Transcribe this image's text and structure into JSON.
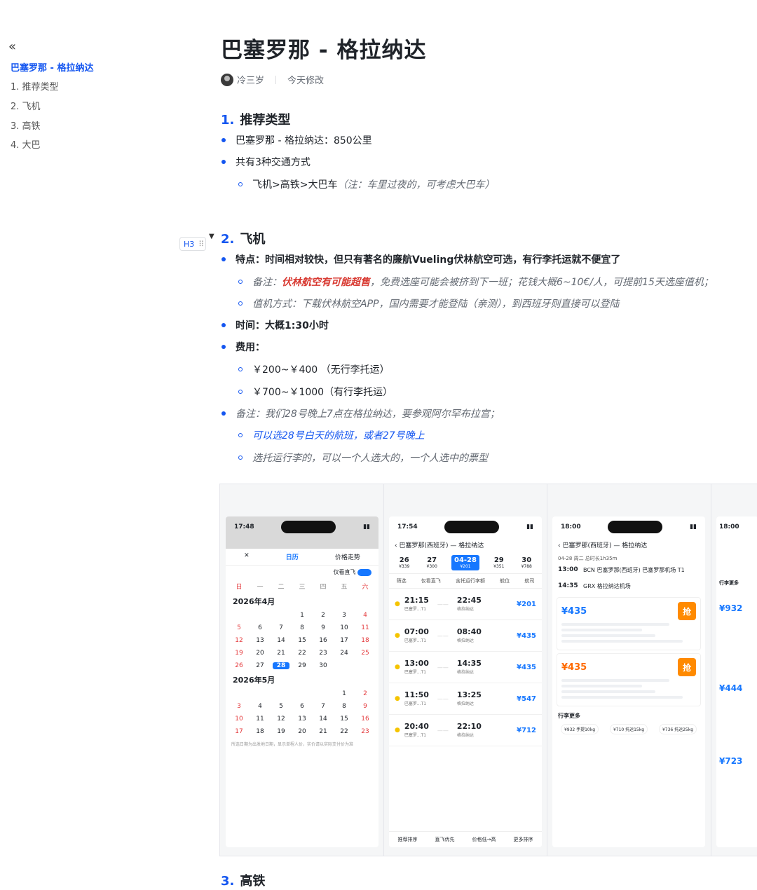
{
  "sidebar": {
    "collapse_icon": "«",
    "title": "巴塞罗那 - 格拉纳达",
    "items": [
      "1. 推荐类型",
      "2. 飞机",
      "3. 高铁",
      "4. 大巴"
    ]
  },
  "doc": {
    "title": "巴塞罗那 - 格拉纳达",
    "author": "冷三岁",
    "modified": "今天修改"
  },
  "sec1": {
    "num": "1.",
    "heading": "推荐类型",
    "b1": "巴塞罗那 - 格拉纳达：850公里",
    "b2": "共有3种交通方式",
    "b2a_main": "飞机>高铁>大巴车",
    "b2a_note": "（注：车里过夜的，可考虑大巴车）"
  },
  "sec2": {
    "num": "2.",
    "heading": "飞机",
    "h3_tag": "H3",
    "b1": "特点：时间相对较快，但只有著名的廉航Vueling伏林航空可选，有行李托运就不便宜了",
    "b1a_pre": "备注：",
    "b1a_red": "伏林航空有可能超售",
    "b1a_post": "，免费选座可能会被挤到下一班；花钱大概6~10€/人，可提前15天选座值机；",
    "b1b": "值机方式：下载伏林航空APP，国内需要才能登陆（亲测），到西班牙则直接可以登陆",
    "b2": "时间：大概1:30小时",
    "b3": "费用：",
    "b3a": "￥200~￥400 （无行李托运）",
    "b3b": "￥700~￥1000（有行李托运）",
    "b4": "备注：我们28号晚上7点在格拉纳达，要参观阿尔罕布拉宫；",
    "b4a": "可以选28号白天的航班，或者27号晚上",
    "b4b": "选托运行李的，可以一个人选大的，一个人选中的票型"
  },
  "shot1": {
    "time": "17:48",
    "tab_cal": "日历",
    "tab_trend": "价格走势",
    "direct": "仅看直飞",
    "weekdays": [
      "日",
      "一",
      "二",
      "三",
      "四",
      "五",
      "六"
    ],
    "month1": "2026年4月",
    "month2": "2026年5月",
    "apr": [
      [
        "",
        "",
        "",
        "1",
        "2",
        "3",
        "4"
      ],
      [
        "5",
        "6",
        "7",
        "8",
        "9",
        "10",
        "11"
      ],
      [
        "12",
        "13",
        "14",
        "15",
        "16",
        "17",
        "18"
      ],
      [
        "19",
        "20",
        "21",
        "22",
        "23",
        "24",
        "25"
      ],
      [
        "26",
        "27",
        "28",
        "29",
        "30",
        "",
        ""
      ]
    ],
    "may": [
      [
        "",
        "",
        "",
        "",
        "",
        "1",
        "2"
      ],
      [
        "3",
        "4",
        "5",
        "6",
        "7",
        "8",
        "9"
      ],
      [
        "10",
        "11",
        "12",
        "13",
        "14",
        "15",
        "16"
      ],
      [
        "17",
        "18",
        "19",
        "20",
        "21",
        "22",
        "23"
      ]
    ],
    "footer": "所选日期为出发地日期，显示单程人价，实价请以实际支付价为准"
  },
  "shot2": {
    "time": "17:54",
    "route": "巴塞罗那(西班牙) — 格拉纳达",
    "dates": [
      "26",
      "27",
      "04-28",
      "29",
      "30"
    ],
    "prices": [
      "¥339",
      "¥300",
      "¥201",
      "¥351",
      "¥788"
    ],
    "filters": [
      "筛选",
      "仅看直飞",
      "含托运行李额",
      "舱位",
      "航司"
    ],
    "flights": [
      {
        "dep": "21:15",
        "arr": "22:45",
        "price": "¥201"
      },
      {
        "dep": "07:00",
        "arr": "08:40",
        "price": "¥435"
      },
      {
        "dep": "13:00",
        "arr": "14:35",
        "price": "¥435"
      },
      {
        "dep": "11:50",
        "arr": "13:25",
        "price": "¥547"
      },
      {
        "dep": "20:40",
        "arr": "22:10",
        "price": "¥712"
      }
    ],
    "from": "巴塞罗...T1",
    "to": "格拉纳达",
    "nav": [
      "推荐排序",
      "直飞优先",
      "价格低→高",
      "更多排序"
    ]
  },
  "shot3": {
    "time": "18:00",
    "route": "巴塞罗那(西班牙) — 格拉纳达",
    "date": "04-28 周二  总时长1h35m",
    "dep_time": "13:00",
    "dep_ap": "BCN 巴塞罗那(西班牙) 巴塞罗那机场 T1",
    "arr_time": "14:35",
    "arr_ap": "GRX 格拉纳达机场",
    "fare1": "¥435",
    "fare2": "¥435",
    "grab": "抢",
    "more": "行李更多",
    "bag_opts": [
      "¥932 手提10kg",
      "¥710 托运15kg",
      "¥736 托运25kg"
    ]
  },
  "shot4": {
    "time": "18:00",
    "prices": [
      "¥932",
      "¥444",
      "¥723"
    ],
    "more": "行李更多"
  },
  "sec3": {
    "num": "3.",
    "heading": "高铁"
  }
}
